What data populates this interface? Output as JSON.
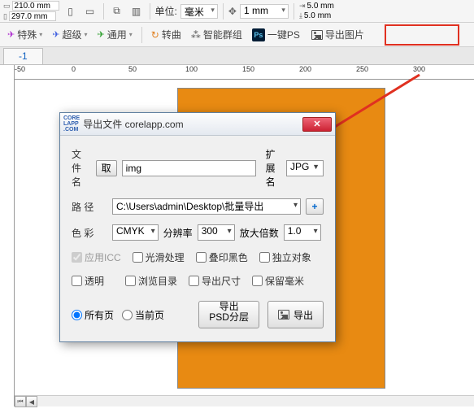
{
  "toolbar1": {
    "width": "210.0 mm",
    "height": "297.0 mm",
    "unit_label": "单位:",
    "unit_value": "毫米",
    "nudge": "1 mm",
    "dup_x": "5.0 mm",
    "dup_y": "5.0 mm"
  },
  "toolbar2": {
    "special": "特殊",
    "super": "超级",
    "common": "通用",
    "curve": "转曲",
    "smart_group": "智能群组",
    "one_key_ps": "一键PS",
    "export_img": "导出图片"
  },
  "tab": "-1",
  "ruler": [
    "-50",
    "0",
    "50",
    "100",
    "150",
    "200",
    "250",
    "300"
  ],
  "dialog": {
    "title": "导出文件 corelapp.com",
    "filename_label": "文件名",
    "get_btn": "取",
    "filename_value": "img",
    "ext_label": "扩展名",
    "ext_value": "JPG",
    "path_label": "路   径",
    "path_value": "C:\\Users\\admin\\Desktop\\批量导出",
    "color_label": "色  彩",
    "color_value": "CMYK",
    "dpi_label": "分辨率",
    "dpi_value": "300",
    "scale_label": "放大倍数",
    "scale_value": "1.0",
    "apply_icc": "应用ICC",
    "smooth": "光滑处理",
    "overprint": "叠印黑色",
    "independent": "独立对象",
    "transparent": "透明",
    "browse": "浏览目录",
    "export_size": "导出尺寸",
    "keep_mm": "保留毫米",
    "all_pages": "所有页",
    "current_page": "当前页",
    "export_psd_l1": "导出",
    "export_psd_l2": "PSD分层",
    "export_btn": "导出"
  }
}
